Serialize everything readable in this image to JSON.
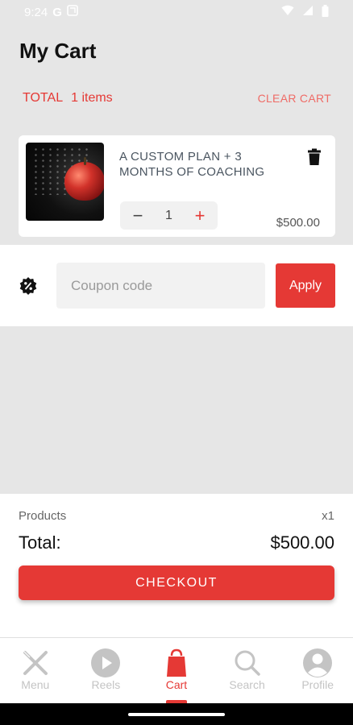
{
  "status_bar": {
    "time": "9:24",
    "g_label": "G"
  },
  "header": {
    "title": "My Cart"
  },
  "totals": {
    "total_label": "TOTAL",
    "items_count": "1 items",
    "clear_label": "CLEAR CART"
  },
  "cart_item": {
    "title": "A CUSTOM PLAN + 3 MONTHS OF COACHING",
    "quantity": "1",
    "price": "$500.00",
    "minus_symbol": "−",
    "plus_symbol": "+"
  },
  "coupon": {
    "placeholder": "Coupon code",
    "apply_label": "Apply"
  },
  "summary": {
    "products_label": "Products",
    "products_count": "x1",
    "total_label": "Total:",
    "total_value": "$500.00",
    "checkout_label": "CHECKOUT"
  },
  "bottom_nav": {
    "items": [
      {
        "label": "Menu",
        "icon": "utensils-icon"
      },
      {
        "label": "Reels",
        "icon": "play-icon"
      },
      {
        "label": "Cart",
        "icon": "shopping-bag-icon",
        "active": true
      },
      {
        "label": "Search",
        "icon": "search-icon"
      },
      {
        "label": "Profile",
        "icon": "profile-icon"
      }
    ]
  },
  "colors": {
    "accent": "#e53935",
    "background": "#e6e6e6",
    "inactive": "#c4c4c4"
  }
}
